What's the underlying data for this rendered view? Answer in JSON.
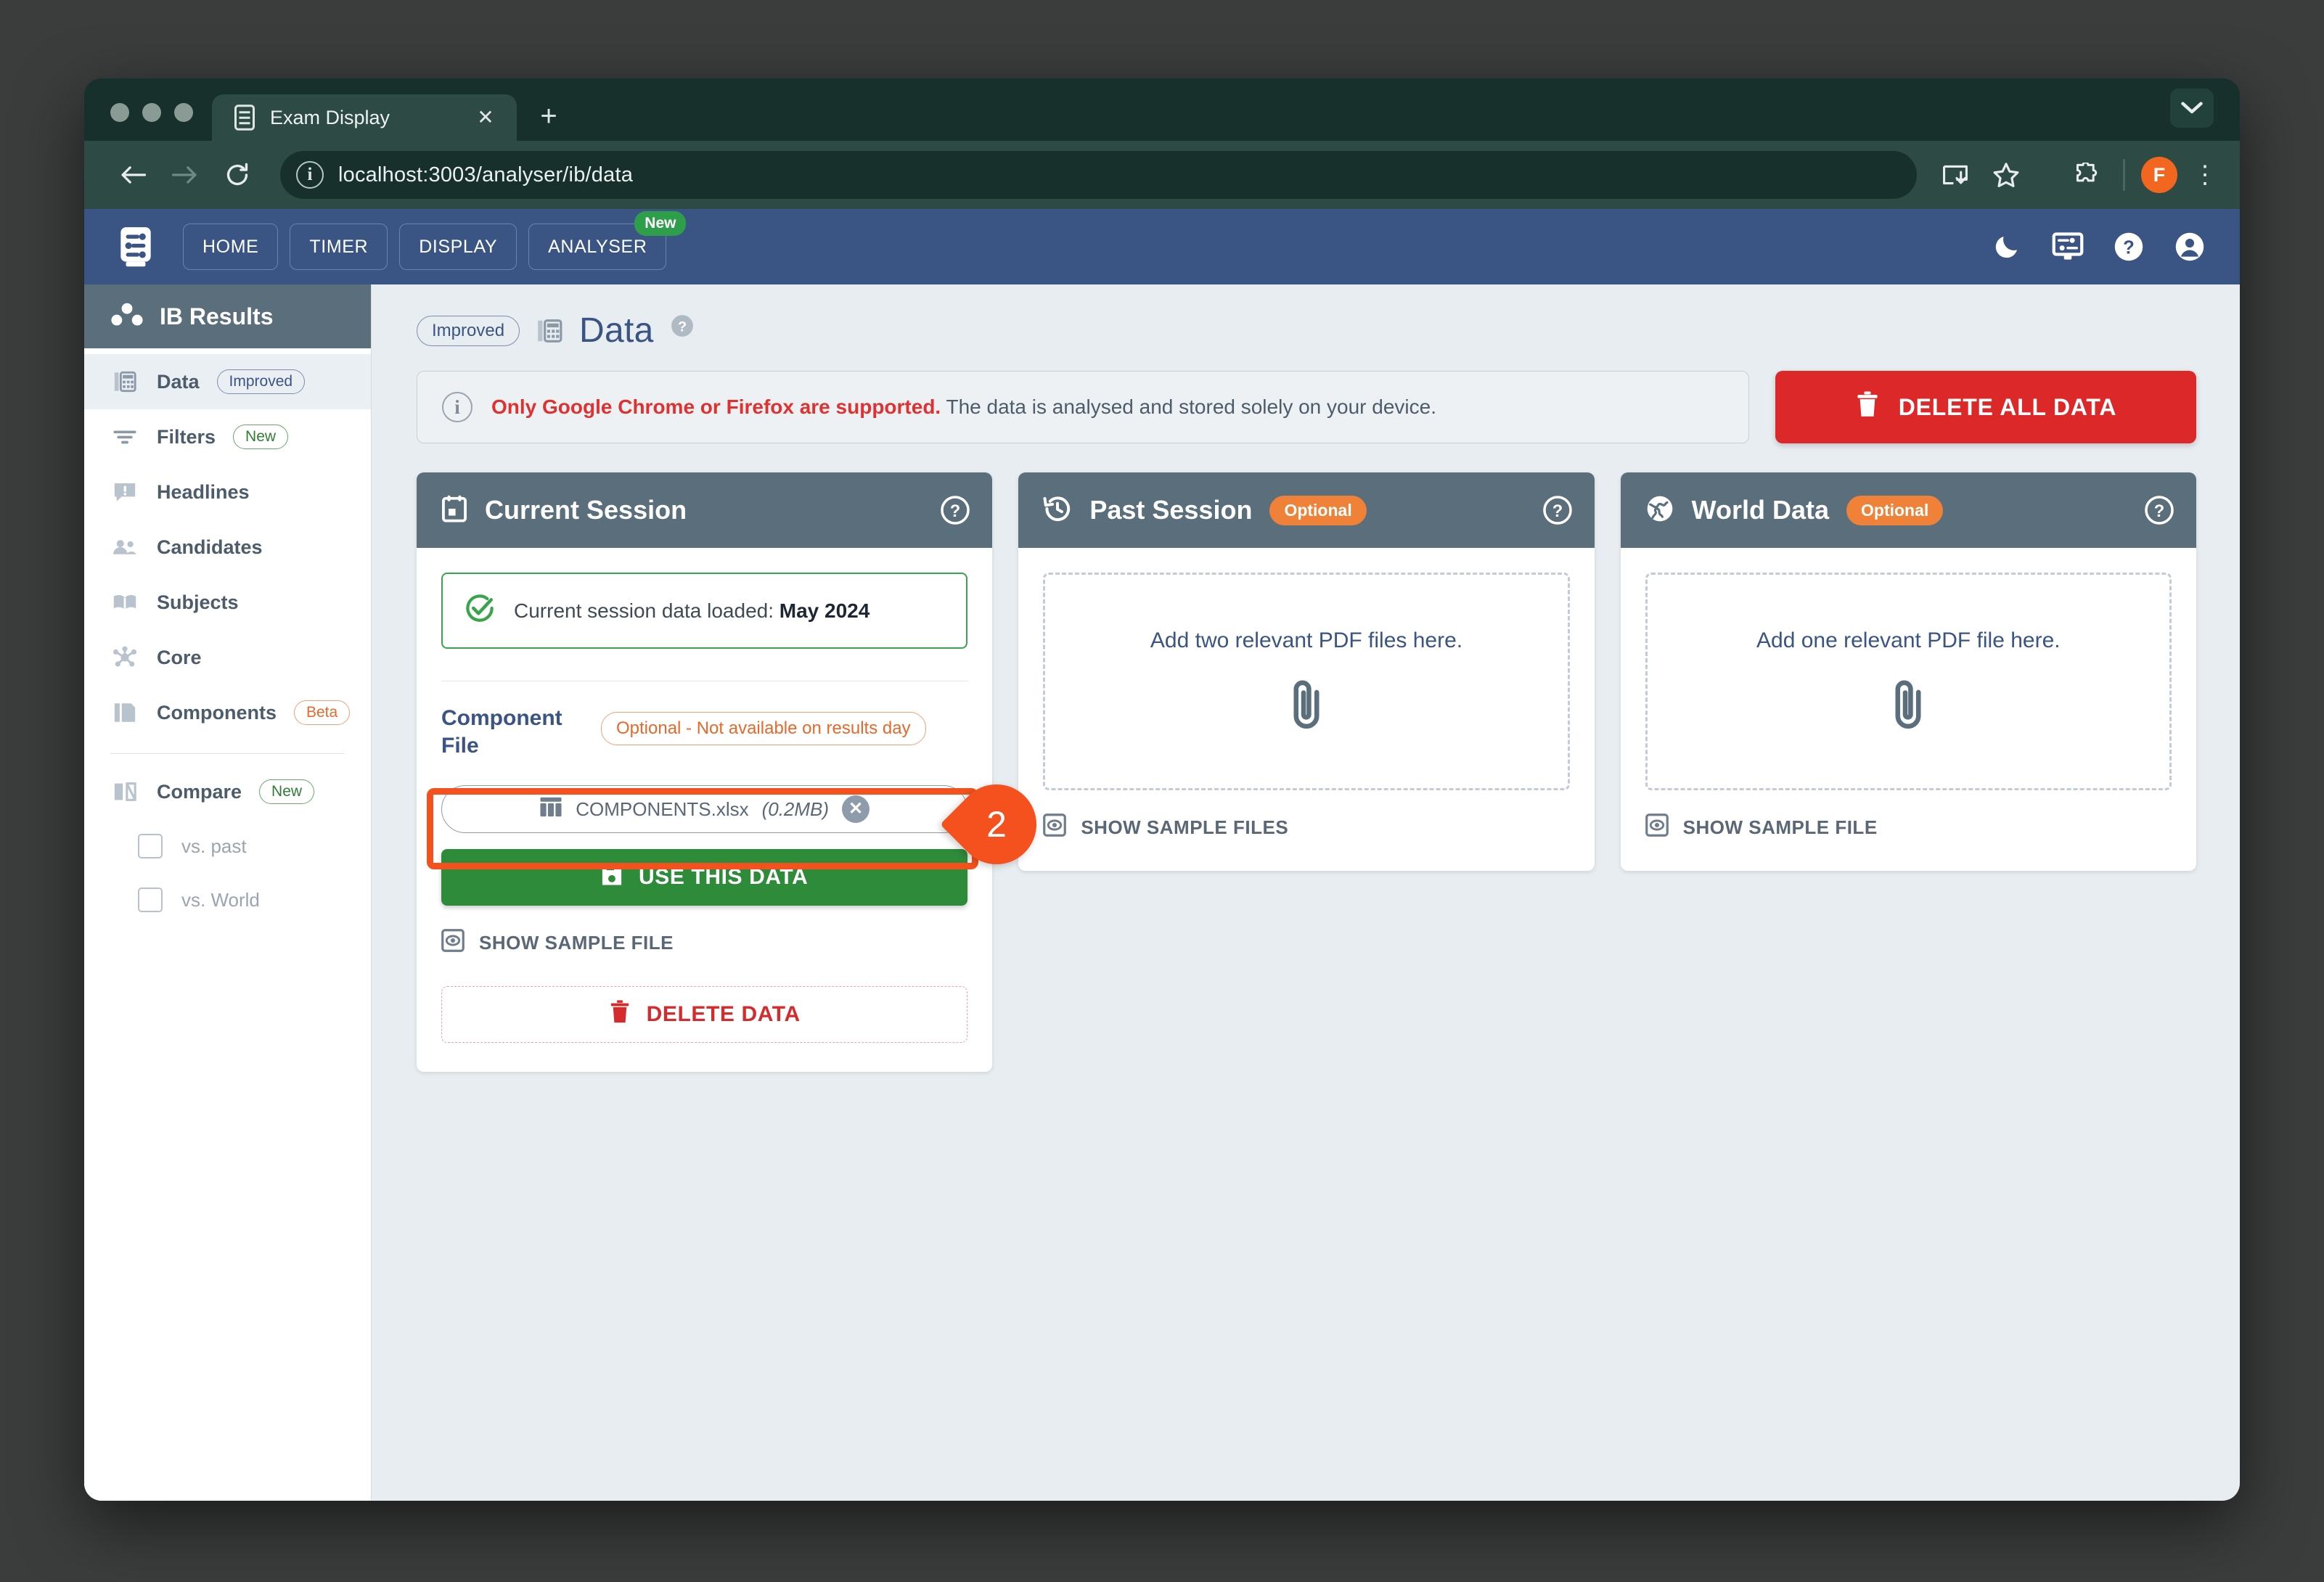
{
  "browser": {
    "tab": {
      "title": "Exam Display",
      "favicon_icon": "exam-display-favicon",
      "close_icon": "close-icon"
    },
    "new_tab_label": "+",
    "tab_list_icon": "chevron-down-icon",
    "back_icon": "back-arrow-icon",
    "forward_icon": "forward-arrow-icon",
    "reload_icon": "reload-icon",
    "site_info_icon": "info-icon",
    "url": "localhost:3003/analyser/ib/data",
    "install_icon": "install-app-icon",
    "bookmark_icon": "star-icon",
    "extensions_icon": "puzzle-piece-icon",
    "profile_initial": "F",
    "menu_icon": "kebab-menu-icon"
  },
  "appnav": {
    "logo_icon": "exam-display-logo",
    "items": [
      {
        "label": "HOME",
        "badge": ""
      },
      {
        "label": "TIMER",
        "badge": ""
      },
      {
        "label": "DISPLAY",
        "badge": ""
      },
      {
        "label": "ANALYSER",
        "badge": "New"
      }
    ],
    "right_icons": [
      {
        "name": "dark-mode-moon-icon"
      },
      {
        "name": "display-settings-icon"
      },
      {
        "name": "help-circle-icon"
      },
      {
        "name": "account-circle-icon"
      }
    ]
  },
  "sidebar": {
    "header": {
      "title": "IB Results",
      "icon": "dots-cluster-icon"
    },
    "items": [
      {
        "label": "Data",
        "badge": "Improved",
        "badge_style": "improved",
        "icon": "table-data-icon",
        "active": true
      },
      {
        "label": "Filters",
        "badge": "New",
        "badge_style": "new",
        "icon": "filter-icon",
        "active": false
      },
      {
        "label": "Headlines",
        "badge": "",
        "badge_style": "",
        "icon": "announcement-icon",
        "active": false
      },
      {
        "label": "Candidates",
        "badge": "",
        "badge_style": "",
        "icon": "people-icon",
        "active": false
      },
      {
        "label": "Subjects",
        "badge": "",
        "badge_style": "",
        "icon": "book-icon",
        "active": false
      },
      {
        "label": "Core",
        "badge": "",
        "badge_style": "",
        "icon": "hub-icon",
        "active": false
      },
      {
        "label": "Components",
        "badge": "Beta",
        "badge_style": "beta",
        "icon": "copy-pages-icon",
        "active": false
      }
    ],
    "compare": {
      "label": "Compare",
      "badge": "New",
      "icon": "compare-icon"
    },
    "compare_options": [
      {
        "label": "vs. past",
        "checked": false
      },
      {
        "label": "vs. World",
        "checked": false
      }
    ]
  },
  "page": {
    "pill": "Improved",
    "icon": "table-data-icon",
    "title": "Data",
    "help_icon": "help-circle-icon"
  },
  "banner": {
    "icon": "info-icon",
    "warning": "Only Google Chrome or Firefox are supported.",
    "text": " The data is analysed and stored solely on your device."
  },
  "delete_all": {
    "label": "DELETE ALL DATA",
    "icon": "trash-icon",
    "color": "#dc2828"
  },
  "cards": {
    "current_session": {
      "title": "Current Session",
      "icon": "calendar-icon",
      "help_icon": "help-circle-icon",
      "loaded_icon": "check-circle-icon",
      "loaded_text": "Current session data loaded:",
      "loaded_value": "May 2024",
      "field_label": "Component File",
      "field_tag": "Optional - Not available on results day",
      "file_icon": "spreadsheet-icon",
      "file_name": "COMPONENTS.xlsx",
      "file_size": "(0.2MB)",
      "file_remove_icon": "remove-circle-icon",
      "use_button": {
        "label": "USE THIS DATA",
        "icon": "save-icon",
        "color": "#2e8b3a"
      },
      "sample_link": {
        "label": "SHOW SAMPLE FILE",
        "icon": "preview-icon"
      },
      "delete_button": {
        "label": "DELETE DATA",
        "icon": "trash-icon",
        "color": "#d42c2c"
      }
    },
    "past_session": {
      "title": "Past Session",
      "badge": "Optional",
      "icon": "history-icon",
      "help_icon": "help-circle-icon",
      "dropzone_text": "Add two relevant PDF files here.",
      "dropzone_icon": "paperclip-icon",
      "sample_link": {
        "label": "SHOW SAMPLE FILES",
        "icon": "preview-icon"
      }
    },
    "world_data": {
      "title": "World Data",
      "badge": "Optional",
      "icon": "globe-icon",
      "help_icon": "help-circle-icon",
      "dropzone_text": "Add one relevant PDF file here.",
      "dropzone_icon": "paperclip-icon",
      "sample_link": {
        "label": "SHOW SAMPLE FILE",
        "icon": "preview-icon"
      }
    }
  },
  "annotation": {
    "step_number": "2",
    "color": "#f4511e"
  }
}
